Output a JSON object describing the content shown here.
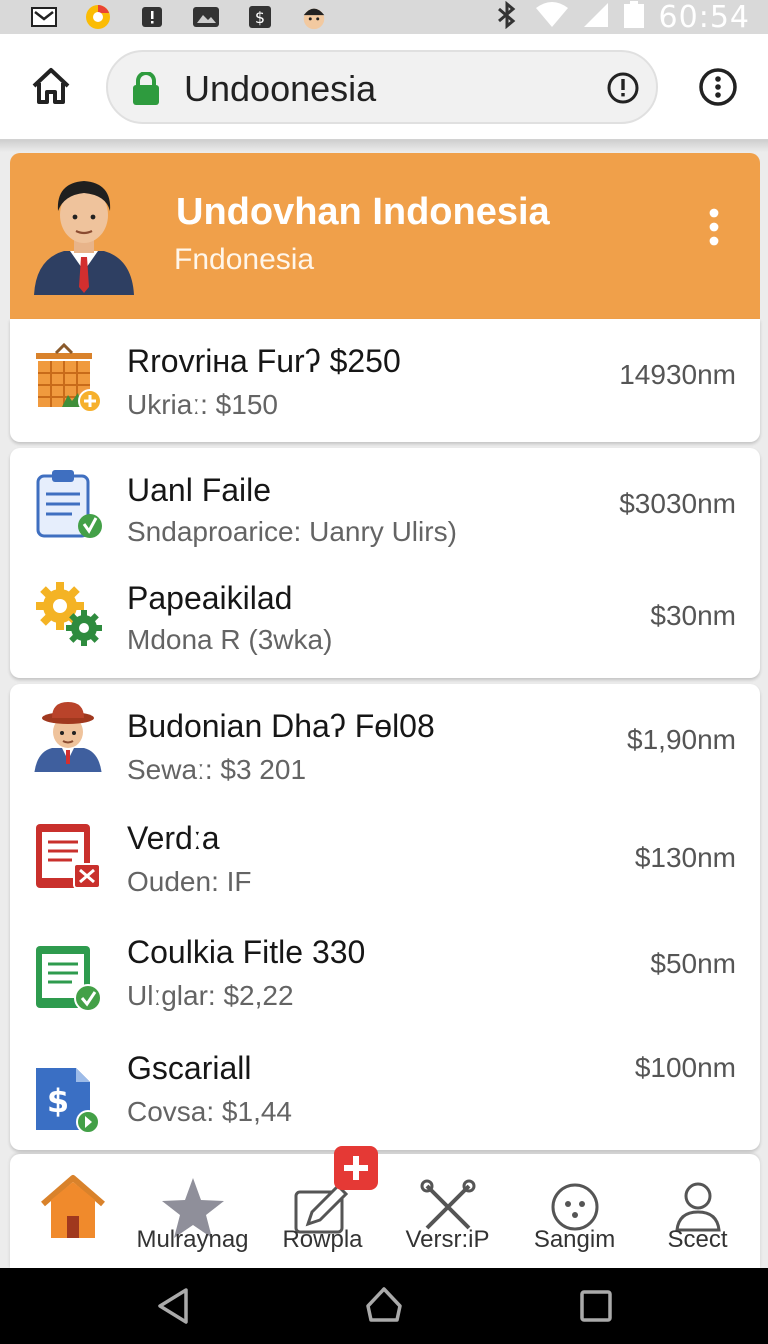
{
  "status_bar": {
    "time": "60:54",
    "left_icons": [
      "mail-icon",
      "chrome-icon",
      "alert-icon",
      "photo-icon",
      "dollar-icon",
      "face-icon"
    ],
    "right_icons": [
      "bluetooth-icon",
      "wifi-icon",
      "signal-icon",
      "battery-icon"
    ]
  },
  "browser": {
    "url": "Undoonesia",
    "home_icon": "home-icon",
    "lock_icon": "lock-icon",
    "info_icon": "info-icon",
    "menu_icon": "more-vertical-icon"
  },
  "header": {
    "title": "Undovhan Indonesia",
    "subtitle": "Fndonesia",
    "color": "#f0a04a"
  },
  "rows": [
    {
      "icon": "shop-basket-icon",
      "title": "Rrovriʜa Furʔ $250",
      "subtitle": "Ukriaː: $150",
      "value": "14930nm"
    },
    {
      "icon": "clipboard-icon",
      "title": "Uanl Faile",
      "subtitle": "Sndaproarice: Uanry Ulirs)",
      "value": "$3030nm"
    },
    {
      "icon": "gears-icon",
      "title": "Papeaikilad",
      "subtitle": "Mdona R (3wka)",
      "value": "$30nm"
    },
    {
      "icon": "person-hat-icon",
      "title": "Budonian Dhaʔ Fөl08",
      "subtitle": "Sewaː: $3 201",
      "value": "$1,90nm"
    },
    {
      "icon": "document-error-icon",
      "title": "Verdːa",
      "subtitle": "Ouden: IF",
      "value": "$130nm"
    },
    {
      "icon": "document-check-icon",
      "title": "Coulkia Fitle 330",
      "subtitle": "Ulːglar: $2,22",
      "value": "$50nm"
    },
    {
      "icon": "money-document-icon",
      "title": "Gscariall",
      "subtitle": "Covsa: $1,44",
      "value": "$100nm"
    }
  ],
  "bottom_nav": [
    {
      "icon": "home-icon",
      "label": ""
    },
    {
      "icon": "star-icon",
      "label": "Mulraynag"
    },
    {
      "icon": "edit-icon",
      "label": "Rowpla"
    },
    {
      "icon": "tools-icon",
      "label": "Versr:iP"
    },
    {
      "icon": "dots-circle-icon",
      "label": "Sangim"
    },
    {
      "icon": "person-icon",
      "label": "Scect"
    }
  ],
  "system_nav": [
    "back-icon",
    "home-circle-icon",
    "recents-icon"
  ]
}
